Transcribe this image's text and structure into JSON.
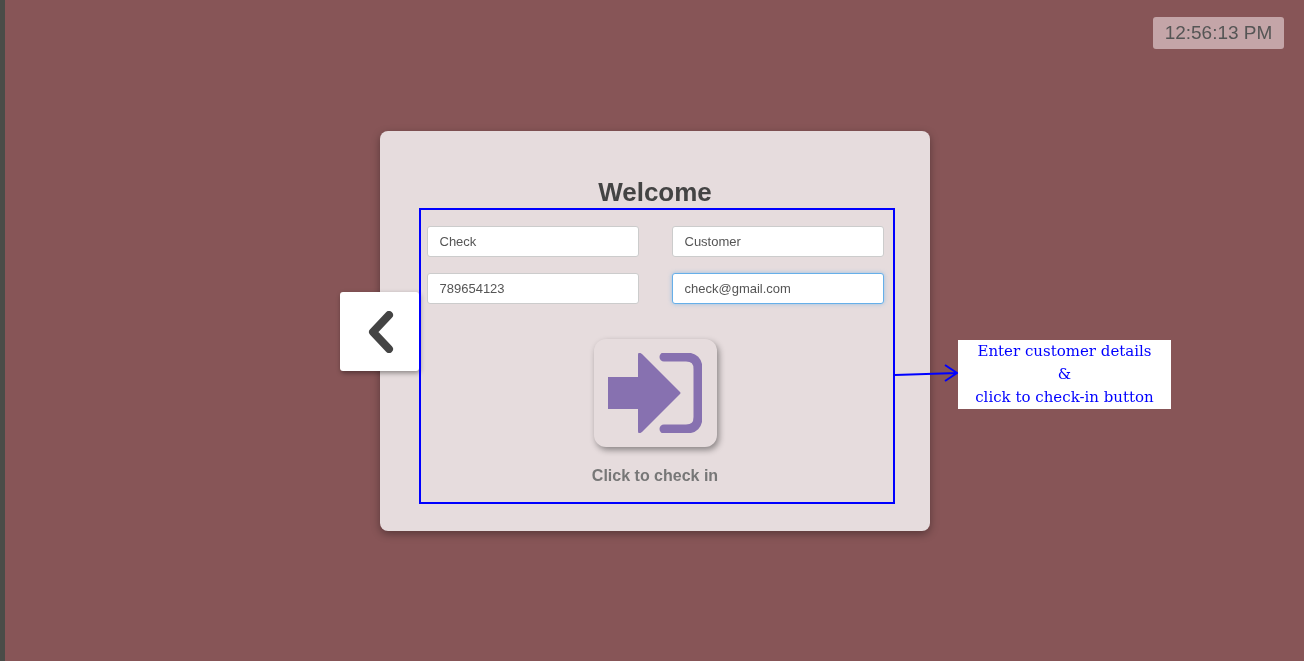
{
  "clock": "12:56:13 PM",
  "card": {
    "title": "Welcome",
    "fields": [
      {
        "value": "Check",
        "focused": false
      },
      {
        "value": "Customer",
        "focused": false
      },
      {
        "value": "789654123",
        "focused": false
      },
      {
        "value": "check@gmail.com",
        "focused": true
      }
    ],
    "check_in_label": "Click to check in"
  },
  "annotation": {
    "lines": [
      "Enter customer details",
      "&",
      "click to check-in button"
    ]
  }
}
